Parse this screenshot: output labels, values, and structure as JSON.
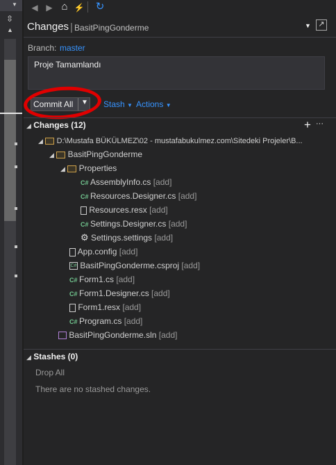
{
  "toolbar": {
    "back": "◀",
    "forward": "▶",
    "home": "⌂",
    "plug": "⚡",
    "refresh": "↻"
  },
  "header": {
    "title": "Changes",
    "separator": "|",
    "repo": "BasitPingGonderme"
  },
  "branch": {
    "label": "Branch:",
    "name": "master"
  },
  "commit_message": "Proje Tamamlandı",
  "actions": {
    "commit_all": "Commit All",
    "stash": "Stash",
    "actions": "Actions"
  },
  "changes": {
    "header": "Changes (12)",
    "add_icon": "+",
    "more_icon": "···",
    "root_path": "D:\\Mustafa BÜKÜLMEZ\\02 - mustafabukulmez.com\\Sitedeki Projeler\\B...",
    "project_folder": "BasitPingGonderme",
    "properties_folder": "Properties",
    "add_tag": "[add]",
    "files": [
      {
        "name": "AssemblyInfo.cs",
        "tag": "[add]"
      },
      {
        "name": "Resources.Designer.cs",
        "tag": "[add]"
      },
      {
        "name": "Resources.resx",
        "tag": "[add]"
      },
      {
        "name": "Settings.Designer.cs",
        "tag": "[add]"
      },
      {
        "name": "Settings.settings",
        "tag": "[add]"
      },
      {
        "name": "App.config",
        "tag": "[add]"
      },
      {
        "name": "BasitPingGonderme.csproj",
        "tag": "[add]"
      },
      {
        "name": "Form1.cs",
        "tag": "[add]"
      },
      {
        "name": "Form1.Designer.cs",
        "tag": "[add]"
      },
      {
        "name": "Form1.resx",
        "tag": "[add]"
      },
      {
        "name": "Program.cs",
        "tag": "[add]"
      },
      {
        "name": "BasitPingGonderme.sln",
        "tag": "[add]"
      }
    ]
  },
  "stashes": {
    "header": "Stashes (0)",
    "drop_all": "Drop All",
    "empty": "There are no stashed changes."
  }
}
